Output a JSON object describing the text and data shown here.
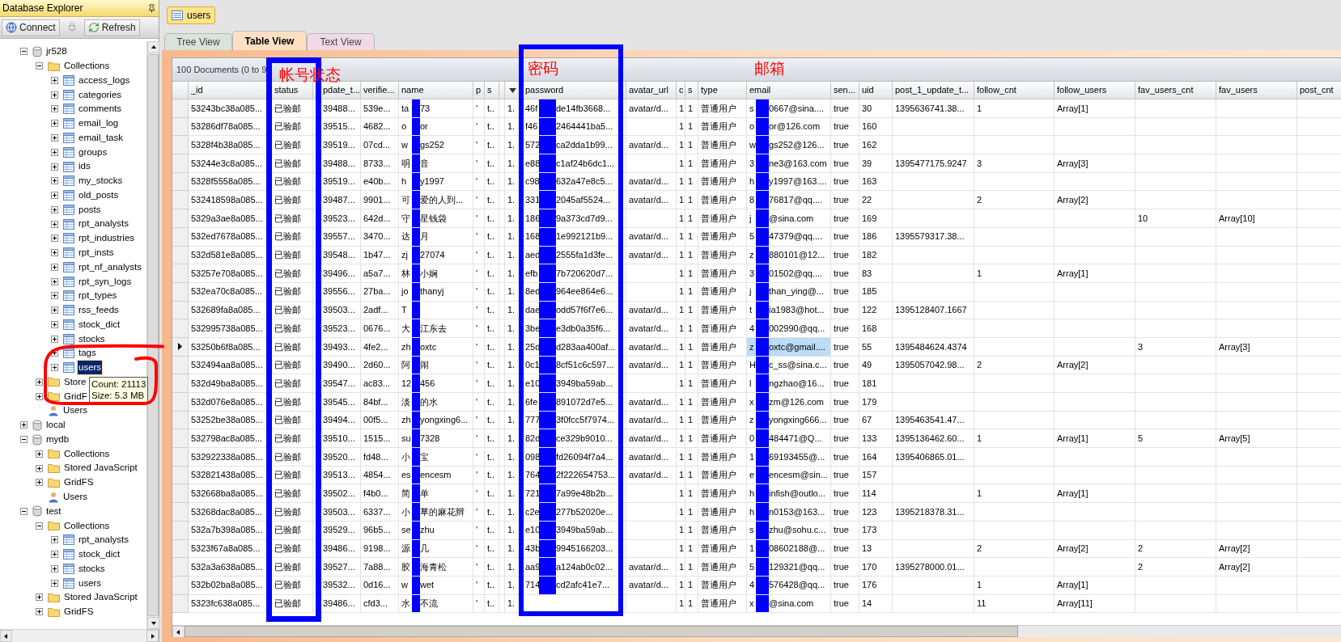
{
  "explorer": {
    "title": "Database Explorer",
    "toolbar": [
      {
        "label": "Connect",
        "disabled": false
      },
      {
        "disabled": true
      },
      {
        "label": "Refresh",
        "disabled": false
      }
    ],
    "tree": [
      {
        "kind": "database",
        "label": "jr528",
        "expanded": true,
        "selected": false,
        "children": [
          {
            "kind": "folder",
            "label": "Collections",
            "expanded": true,
            "selected": false,
            "children": [
              {
                "kind": "collection",
                "label": "access_logs",
                "expanded": false,
                "selected": false
              },
              {
                "kind": "collection",
                "label": "categories",
                "expanded": false,
                "selected": false
              },
              {
                "kind": "collection",
                "label": "comments",
                "expanded": false,
                "selected": false
              },
              {
                "kind": "collection",
                "label": "email_log",
                "expanded": false,
                "selected": false
              },
              {
                "kind": "collection",
                "label": "email_task",
                "expanded": false,
                "selected": false
              },
              {
                "kind": "collection",
                "label": "groups",
                "expanded": false,
                "selected": false
              },
              {
                "kind": "collection",
                "label": "ids",
                "expanded": false,
                "selected": false
              },
              {
                "kind": "collection",
                "label": "my_stocks",
                "expanded": false,
                "selected": false
              },
              {
                "kind": "collection",
                "label": "old_posts",
                "expanded": false,
                "selected": false
              },
              {
                "kind": "collection",
                "label": "posts",
                "expanded": false,
                "selected": false
              },
              {
                "kind": "collection",
                "label": "rpt_analysts",
                "expanded": false,
                "selected": false
              },
              {
                "kind": "collection",
                "label": "rpt_industries",
                "expanded": false,
                "selected": false
              },
              {
                "kind": "collection",
                "label": "rpt_insts",
                "expanded": false,
                "selected": false
              },
              {
                "kind": "collection",
                "label": "rpt_nf_analysts",
                "expanded": false,
                "selected": false
              },
              {
                "kind": "collection",
                "label": "rpt_syn_logs",
                "expanded": false,
                "selected": false
              },
              {
                "kind": "collection",
                "label": "rpt_types",
                "expanded": false,
                "selected": false
              },
              {
                "kind": "collection",
                "label": "rss_feeds",
                "expanded": false,
                "selected": false
              },
              {
                "kind": "collection",
                "label": "stock_dict",
                "expanded": false,
                "selected": false
              },
              {
                "kind": "collection",
                "label": "stocks",
                "expanded": false,
                "selected": false
              },
              {
                "kind": "collection",
                "label": "tags",
                "expanded": false,
                "selected": false
              },
              {
                "kind": "collection",
                "label": "users",
                "expanded": false,
                "selected": true
              }
            ]
          },
          {
            "kind": "folder",
            "label": "Store",
            "expanded": false,
            "selected": false
          },
          {
            "kind": "folder",
            "label": "GridF",
            "expanded": false,
            "selected": false
          },
          {
            "kind": "user",
            "label": "Users",
            "selected": false
          }
        ]
      },
      {
        "kind": "database",
        "label": "local",
        "expanded": false,
        "selected": false
      },
      {
        "kind": "database",
        "label": "mydb",
        "expanded": true,
        "selected": false,
        "children": [
          {
            "kind": "folder",
            "label": "Collections",
            "expanded": false,
            "selected": false
          },
          {
            "kind": "folder",
            "label": "Stored JavaScript",
            "expanded": false,
            "selected": false
          },
          {
            "kind": "folder",
            "label": "GridFS",
            "expanded": false,
            "selected": false
          },
          {
            "kind": "user",
            "label": "Users",
            "selected": false
          }
        ]
      },
      {
        "kind": "database",
        "label": "test",
        "expanded": true,
        "selected": false,
        "children": [
          {
            "kind": "folder",
            "label": "Collections",
            "expanded": true,
            "selected": false,
            "children": [
              {
                "kind": "collection",
                "label": "rpt_analysts",
                "expanded": false,
                "selected": false
              },
              {
                "kind": "collection",
                "label": "stock_dict",
                "expanded": false,
                "selected": false
              },
              {
                "kind": "collection",
                "label": "stocks",
                "expanded": false,
                "selected": false
              },
              {
                "kind": "collection",
                "label": "users",
                "expanded": false,
                "selected": false
              }
            ]
          },
          {
            "kind": "folder",
            "label": "Stored JavaScript",
            "expanded": false,
            "selected": false
          },
          {
            "kind": "folder",
            "label": "GridFS",
            "expanded": false,
            "selected": false
          }
        ]
      }
    ],
    "tooltip": [
      "Count: 21113",
      "Size: 5.3 MB"
    ]
  },
  "documents": [
    {
      "label": "users",
      "selected": true
    }
  ],
  "view_tabs": [
    {
      "label": "Tree View",
      "selected": false,
      "color": "#d6e4da"
    },
    {
      "label": "Table View",
      "selected": true,
      "color": "#fde0c4"
    },
    {
      "label": "Text View",
      "selected": false,
      "color": "#f2d9e6"
    }
  ],
  "table": {
    "summary": "100 Documents (0 to 9",
    "annotations": [
      "帐号状态",
      "密码",
      "邮箱"
    ],
    "columns": [
      {
        "kind": "text",
        "label": "_id"
      },
      {
        "kind": "text",
        "label": "status"
      },
      {
        "kind": "text",
        "label": "pdate_t..."
      },
      {
        "kind": "text",
        "label": "verifie..."
      },
      {
        "kind": "text",
        "label": "name"
      },
      {
        "kind": "text",
        "label": "p"
      },
      {
        "kind": "text",
        "label": "s"
      },
      {
        "kind": "blank"
      },
      {
        "kind": "menu"
      },
      {
        "kind": "text",
        "label": "password"
      },
      {
        "kind": "text",
        "label": "avatar_url"
      },
      {
        "kind": "text",
        "label": "c"
      },
      {
        "kind": "text",
        "label": "s"
      },
      {
        "kind": "text",
        "label": "type"
      },
      {
        "kind": "text",
        "label": "email"
      },
      {
        "kind": "text",
        "label": "sen..."
      },
      {
        "kind": "text",
        "label": "uid"
      },
      {
        "kind": "text",
        "label": "post_1_update_t..."
      },
      {
        "kind": "text",
        "label": "follow_cnt"
      },
      {
        "kind": "text",
        "label": "follow_users"
      },
      {
        "kind": "text",
        "label": "fav_users_cnt"
      },
      {
        "kind": "text",
        "label": "fav_users"
      },
      {
        "kind": "text",
        "label": "post_cnt"
      }
    ],
    "rows": [
      {
        "selected": false,
        "cells": [
          "53243bc38a085...",
          "已验邮",
          "39488...",
          "539e...",
          {
            "before": "ta",
            "after": "73"
          },
          "'",
          "t..",
          null,
          "1.",
          {
            "before": "46f",
            "after": "de14fb3668..."
          },
          "avatar/d...",
          "1",
          "1",
          "普通用户",
          {
            "before": "s",
            "after": "0667@sina....",
            "selected": false
          },
          "true",
          "30",
          "1395636741.38...",
          "1",
          "Array[1]",
          null,
          null,
          null
        ]
      },
      {
        "selected": false,
        "cells": [
          "53286df78a085...",
          "已验邮",
          "39515...",
          "4682...",
          {
            "before": "o",
            "after": "or"
          },
          "'",
          "t..",
          null,
          "1.",
          {
            "before": "f46",
            "after": "2464441ba5..."
          },
          null,
          "1",
          "1",
          "普通用户",
          {
            "before": "o",
            "after": "or@126.com",
            "selected": false
          },
          "true",
          "160",
          null,
          null,
          null,
          null,
          null,
          null
        ]
      },
      {
        "selected": false,
        "cells": [
          "5328f4b38a085...",
          "已验邮",
          "39519...",
          "07cd...",
          {
            "before": "w",
            "after": "gs252"
          },
          "'",
          "t..",
          null,
          "1.",
          {
            "before": "572",
            "after": "ca2dda1b99..."
          },
          "avatar/d...",
          "1",
          "1",
          "普通用户",
          {
            "before": "w",
            "after": "gs252@126...",
            "selected": false
          },
          "true",
          "162",
          null,
          null,
          null,
          null,
          null,
          null
        ]
      },
      {
        "selected": false,
        "cells": [
          "53244e3c8a085...",
          "已验邮",
          "39488...",
          "8733...",
          {
            "before": "明",
            "after": "音"
          },
          "'",
          "t..",
          null,
          "1.",
          {
            "before": "e88",
            "after": "c1af24b6dc1..."
          },
          null,
          "1",
          "1",
          "普通用户",
          {
            "before": "3",
            "after": "ne3@163.com",
            "selected": false
          },
          "true",
          "39",
          "1395477175.9247",
          "3",
          "Array[3]",
          null,
          null,
          null
        ]
      },
      {
        "selected": false,
        "cells": [
          "5328f5558a085...",
          "已验邮",
          "39519...",
          "e40b...",
          {
            "before": "h",
            "after": "y1997"
          },
          "'",
          "t..",
          null,
          "1.",
          {
            "before": "c98",
            "after": "632a47e8c5..."
          },
          "avatar/d...",
          "1",
          "1",
          "普通用户",
          {
            "before": "h",
            "after": "y1997@163....",
            "selected": false
          },
          "true",
          "163",
          null,
          null,
          null,
          null,
          null,
          null
        ]
      },
      {
        "selected": false,
        "cells": [
          "532418598a085...",
          "已验邮",
          "39487...",
          "9901...",
          {
            "before": "可",
            "after": "爱的人到..."
          },
          "'",
          "t..",
          null,
          "1.",
          {
            "before": "331",
            "after": "2045af5524..."
          },
          "avatar/d...",
          "1",
          "1",
          "普通用户",
          {
            "before": "8",
            "after": "76817@qq....",
            "selected": false
          },
          "true",
          "22",
          null,
          "2",
          "Array[2]",
          null,
          null,
          null
        ]
      },
      {
        "selected": false,
        "cells": [
          "5329a3ae8a085...",
          "已验邮",
          "39523...",
          "642d...",
          {
            "before": "守",
            "after": "星钱袋"
          },
          "'",
          "t..",
          null,
          "1.",
          {
            "before": "186",
            "after": "9a373cd7d9..."
          },
          null,
          "1",
          "1",
          "普通用户",
          {
            "before": "j",
            "after": "@sina.com",
            "selected": false
          },
          "true",
          "169",
          null,
          null,
          null,
          "10",
          "Array[10]",
          null
        ]
      },
      {
        "selected": false,
        "cells": [
          "532ed7678a085...",
          "已验邮",
          "39557...",
          "3470...",
          {
            "before": "达",
            "after": "月"
          },
          "'",
          "t..",
          null,
          "1.",
          {
            "before": "168",
            "after": "1e992121b9..."
          },
          "avatar/d...",
          "1",
          "1",
          "普通用户",
          {
            "before": "5",
            "after": "47379@qq....",
            "selected": false
          },
          "true",
          "186",
          "1395579317.38...",
          null,
          null,
          null,
          null,
          null
        ]
      },
      {
        "selected": false,
        "cells": [
          "532d581e8a085...",
          "已验邮",
          "39548...",
          "1b47...",
          {
            "before": "zj",
            "after": "27074"
          },
          "'",
          "t..",
          null,
          "1.",
          {
            "before": "aed",
            "after": "2555fa1d3fe..."
          },
          "avatar/d...",
          "1",
          "1",
          "普通用户",
          {
            "before": "z",
            "after": "880101@12...",
            "selected": false
          },
          "true",
          "182",
          null,
          null,
          null,
          null,
          null,
          null
        ]
      },
      {
        "selected": false,
        "cells": [
          "53257e708a085...",
          "已验邮",
          "39496...",
          "a5a7...",
          {
            "before": "林",
            "after": "小娴"
          },
          "'",
          "t..",
          null,
          "1.",
          {
            "before": "efb",
            "after": "7b720620d7..."
          },
          null,
          "1",
          "1",
          "普通用户",
          {
            "before": "3",
            "after": "01502@qq....",
            "selected": false
          },
          "true",
          "83",
          null,
          "1",
          "Array[1]",
          null,
          null,
          null
        ]
      },
      {
        "selected": false,
        "cells": [
          "532ea70c8a085...",
          "已验邮",
          "39556...",
          "27ba...",
          {
            "before": "jo",
            "after": "thanyj"
          },
          "'",
          "t..",
          null,
          "1.",
          {
            "before": "8ed",
            "after": "964ee864e6..."
          },
          null,
          "1",
          "1",
          "普通用户",
          {
            "before": "j",
            "after": "than_ying@...",
            "selected": false
          },
          "true",
          "185",
          null,
          null,
          null,
          null,
          null,
          null
        ]
      },
      {
        "selected": false,
        "cells": [
          "532689fa8a085...",
          "已验邮",
          "39503...",
          "2adf...",
          {
            "before": "T"
          },
          "'",
          "t..",
          null,
          "1.",
          {
            "before": "dae",
            "after": "odd57f6f7e6..."
          },
          "avatar/d...",
          "1",
          "1",
          "普通用户",
          {
            "before": "t",
            "after": "ia1983@hot...",
            "selected": false
          },
          "true",
          "122",
          "1395128407.1667",
          null,
          null,
          null,
          null,
          null
        ]
      },
      {
        "selected": false,
        "cells": [
          "532995738a085...",
          "已验邮",
          "39523...",
          "0676...",
          {
            "before": "大",
            "after": "江东去"
          },
          "'",
          "t..",
          null,
          "1.",
          {
            "before": "3be",
            "after": "e3db0a35f6..."
          },
          "avatar/d...",
          "1",
          "1",
          "普通用户",
          {
            "before": "4",
            "after": "002990@qq...",
            "selected": false
          },
          "true",
          "168",
          null,
          null,
          null,
          null,
          null,
          null
        ]
      },
      {
        "selected": true,
        "cells": [
          "53250b6f8a085...",
          "已验邮",
          "39493...",
          "4fe2...",
          {
            "before": "zh",
            "after": "oxtc"
          },
          "'",
          "t..",
          null,
          "1.",
          {
            "before": "25d",
            "after": "d283aa400af..."
          },
          "avatar/d...",
          "1",
          "1",
          "普通用户",
          {
            "before": "z",
            "after": "oxtc@gmail....",
            "selected": true
          },
          "true",
          "55",
          "1395484624.4374",
          null,
          null,
          "3",
          "Array[3]",
          null
        ]
      },
      {
        "selected": false,
        "cells": [
          "532494aa8a085...",
          "已验邮",
          "39490...",
          "2d60...",
          {
            "before": "阿",
            "after": "闹"
          },
          "'",
          "t..",
          null,
          "1.",
          {
            "before": "0c1",
            "after": "8cf51c6c597..."
          },
          "avatar/d...",
          "1",
          "1",
          "普通用户",
          {
            "before": "H",
            "after": "c_ss@sina.c...",
            "selected": false
          },
          "true",
          "49",
          "1395057042.98...",
          "2",
          "Array[2]",
          null,
          null,
          null
        ]
      },
      {
        "selected": false,
        "cells": [
          "532d49ba8a085...",
          "已验邮",
          "39547...",
          "ac83...",
          {
            "before": "12",
            "after": "456"
          },
          "'",
          "t..",
          null,
          "1.",
          {
            "before": "e10",
            "after": "3949ba59ab..."
          },
          null,
          "1",
          "1",
          "普通用户",
          {
            "before": "l",
            "after": "ngzhao@16...",
            "selected": false
          },
          "true",
          "181",
          null,
          null,
          null,
          null,
          null,
          null
        ]
      },
      {
        "selected": false,
        "cells": [
          "532d076e8a085...",
          "已验邮",
          "39545...",
          "84bf...",
          {
            "before": "淡",
            "after": "的水"
          },
          "'",
          "t..",
          null,
          "1.",
          {
            "before": "6fe",
            "after": "891072d7e5..."
          },
          "avatar/d...",
          "1",
          "1",
          "普通用户",
          {
            "before": "x",
            "after": "zm@126.com",
            "selected": false
          },
          "true",
          "179",
          null,
          null,
          null,
          null,
          null,
          null
        ]
      },
      {
        "selected": false,
        "cells": [
          "53252be38a085...",
          "已验邮",
          "39494...",
          "00f5...",
          {
            "before": "zh",
            "after": "yongxing6..."
          },
          "'",
          "t..",
          null,
          "1.",
          {
            "before": "777",
            "after": "3f0fcc5f7974..."
          },
          "avatar/d...",
          "1",
          "1",
          "普通用户",
          {
            "before": "z",
            "after": "yongxing666...",
            "selected": false
          },
          "true",
          "67",
          "1395463541.47...",
          null,
          null,
          null,
          null,
          null
        ]
      },
      {
        "selected": false,
        "cells": [
          "532798ac8a085...",
          "已验邮",
          "39510...",
          "1515...",
          {
            "before": "su",
            "after": "7328"
          },
          "'",
          "t..",
          null,
          "1.",
          {
            "before": "82d",
            "after": "ce329b9010..."
          },
          "avatar/d...",
          "1",
          "1",
          "普通用户",
          {
            "before": "0",
            "after": "484471@Q...",
            "selected": false
          },
          "true",
          "133",
          "1395136462.60...",
          "1",
          "Array[1]",
          "5",
          "Array[5]",
          null
        ]
      },
      {
        "selected": false,
        "cells": [
          "532922338a085...",
          "已验邮",
          "39520...",
          "fd48...",
          {
            "before": "小",
            "after": "宝"
          },
          "'",
          "t..",
          null,
          "1.",
          {
            "before": "098",
            "after": "fd26094f7a4..."
          },
          "avatar/d...",
          "1",
          "1",
          "普通用户",
          {
            "before": "1",
            "after": "69193455@...",
            "selected": false
          },
          "true",
          "164",
          "1395406865.01...",
          null,
          null,
          null,
          null,
          null
        ]
      },
      {
        "selected": false,
        "cells": [
          "532821438a085...",
          "已验邮",
          "39513...",
          "4854...",
          {
            "before": "es",
            "after": "encesm"
          },
          "'",
          "t..",
          null,
          "1.",
          {
            "before": "764",
            "after": "2f222654753..."
          },
          "avatar/d...",
          "1",
          "1",
          "普通用户",
          {
            "before": "e",
            "after": "encesm@sin...",
            "selected": false
          },
          "true",
          "157",
          null,
          null,
          null,
          null,
          null,
          null
        ]
      },
      {
        "selected": false,
        "cells": [
          "532668ba8a085...",
          "已验邮",
          "39502...",
          "f4b0...",
          {
            "before": "简",
            "after": "单"
          },
          "'",
          "t..",
          null,
          "1.",
          {
            "before": "721",
            "after": "7a99e48b2b..."
          },
          null,
          "1",
          "1",
          "普通用户",
          {
            "before": "h",
            "after": "infish@outlo...",
            "selected": false
          },
          "true",
          "114",
          null,
          "1",
          "Array[1]",
          null,
          null,
          null
        ]
      },
      {
        "selected": false,
        "cells": [
          "53268dac8a085...",
          "已验邮",
          "39503...",
          "6337...",
          {
            "before": "小",
            "after": "草的麻花辫"
          },
          "'",
          "t..",
          null,
          "1.",
          {
            "before": "c2e",
            "after": "277b52020e..."
          },
          null,
          "1",
          "1",
          "普通用户",
          {
            "before": "h",
            "after": "n0153@163...",
            "selected": false
          },
          "true",
          "123",
          "1395218378.31...",
          null,
          null,
          null,
          null,
          null
        ]
      },
      {
        "selected": false,
        "cells": [
          "532a7b398a085...",
          "已验邮",
          "39529...",
          "96b5...",
          {
            "before": "se",
            "after": "zhu"
          },
          "'",
          "t..",
          null,
          "1.",
          {
            "before": "e10",
            "after": "3949ba59ab..."
          },
          null,
          "1",
          "1",
          "普通用户",
          {
            "before": "s",
            "after": "zhu@sohu.c...",
            "selected": false
          },
          "true",
          "173",
          null,
          null,
          null,
          null,
          null,
          null
        ]
      },
      {
        "selected": false,
        "cells": [
          "5323f67a8a085...",
          "已验邮",
          "39486...",
          "9198...",
          {
            "before": "源",
            "after": "几"
          },
          "'",
          "t..",
          null,
          "1.",
          {
            "before": "43b",
            "after": "9945166203..."
          },
          null,
          "1",
          "1",
          "普通用户",
          {
            "before": "1",
            "after": "08602188@...",
            "selected": false
          },
          "true",
          "13",
          null,
          "2",
          "Array[2]",
          "2",
          "Array[2]",
          null
        ]
      },
      {
        "selected": false,
        "cells": [
          "532a3a638a085...",
          "已验邮",
          "39527...",
          "7a88...",
          {
            "before": "胶",
            "after": "海青松"
          },
          "'",
          "t..",
          null,
          "1.",
          {
            "before": "aa9",
            "after": "a124ab0c02..."
          },
          "avatar/d...",
          "1",
          "1",
          "普通用户",
          {
            "before": "5",
            "after": "129321@qq...",
            "selected": false
          },
          "true",
          "170",
          "1395278000.01...",
          null,
          null,
          "2",
          "Array[2]",
          null
        ]
      },
      {
        "selected": false,
        "cells": [
          "532b02ba8a085...",
          "已验邮",
          "39532...",
          "0d16...",
          {
            "before": "w",
            "after": "wet"
          },
          "'",
          "t..",
          null,
          "1.",
          {
            "before": "714",
            "after": "cd2afc41e7..."
          },
          "avatar/d...",
          "1",
          "1",
          "普通用户",
          {
            "before": "4",
            "after": "576428@qq...",
            "selected": false
          },
          "true",
          "176",
          null,
          "1",
          "Array[1]",
          null,
          null,
          null
        ]
      },
      {
        "selected": false,
        "cells": [
          "5323fc638a085...",
          "已验邮",
          "39486...",
          "cfd3...",
          {
            "before": "水",
            "after": "不流"
          },
          "'",
          "t..",
          null,
          "1.",
          null,
          null,
          "1",
          "1",
          "普通用户",
          {
            "before": "x",
            "after": "@sina.com",
            "selected": false
          },
          "true",
          "14",
          null,
          "11",
          "Array[11]",
          null,
          null,
          null
        ]
      }
    ]
  }
}
